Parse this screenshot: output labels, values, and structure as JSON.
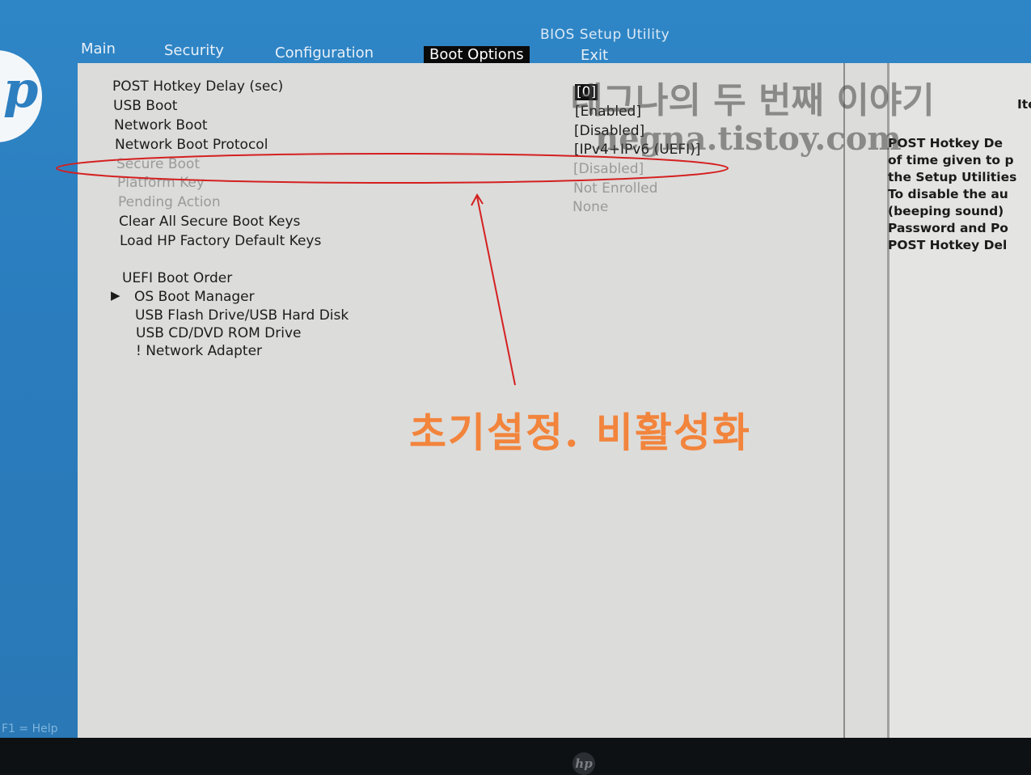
{
  "window": {
    "title": "BIOS Setup Utility"
  },
  "menu": {
    "items": [
      "Main",
      "Security",
      "Configuration",
      "Boot Options",
      "Exit"
    ],
    "active": "Boot Options"
  },
  "settings": [
    {
      "label": "POST Hotkey Delay (sec)",
      "value": "[0]"
    },
    {
      "label": "USB Boot",
      "value": "[Enabled]"
    },
    {
      "label": "Network Boot",
      "value": "[Disabled]"
    },
    {
      "label": "Network Boot Protocol",
      "value": "[IPv4+IPv6 (UEFI)]"
    },
    {
      "label": "Secure Boot",
      "value": "[Disabled]"
    },
    {
      "label": "Platform Key",
      "value": "Not Enrolled"
    },
    {
      "label": "Pending Action",
      "value": "None"
    },
    {
      "label": "Clear All Secure Boot Keys",
      "value": ""
    },
    {
      "label": "Load HP Factory Default Keys",
      "value": ""
    }
  ],
  "boot_order": {
    "header": "UEFI Boot Order",
    "marker": "▶",
    "entries": [
      "OS Boot Manager",
      "USB Flash Drive/USB Hard Disk",
      "USB CD/DVD ROM Drive",
      "! Network Adapter"
    ]
  },
  "help_panel": {
    "heading": "Ite",
    "lines": [
      "POST Hotkey De",
      "of time given to p",
      "the Setup Utilities",
      "To disable the au",
      "(beeping sound)",
      "Password and Po",
      "POST Hotkey Del"
    ]
  },
  "footer": {
    "hint": "F1 = Help"
  },
  "watermark": {
    "line1": "네그나의 두 번째 이야기",
    "line2": "negna.tistoy.com"
  },
  "annotation": {
    "text": "초기설정. 비활성화",
    "color": "#f2843c",
    "outline_color": "#d42020"
  },
  "colors": {
    "screen_blue": "#2f86c6",
    "panel": "#dcdcda",
    "selection": "#111111"
  },
  "icons": {
    "brand": "hp-logo-icon",
    "pointer": "triangle-right-icon"
  }
}
